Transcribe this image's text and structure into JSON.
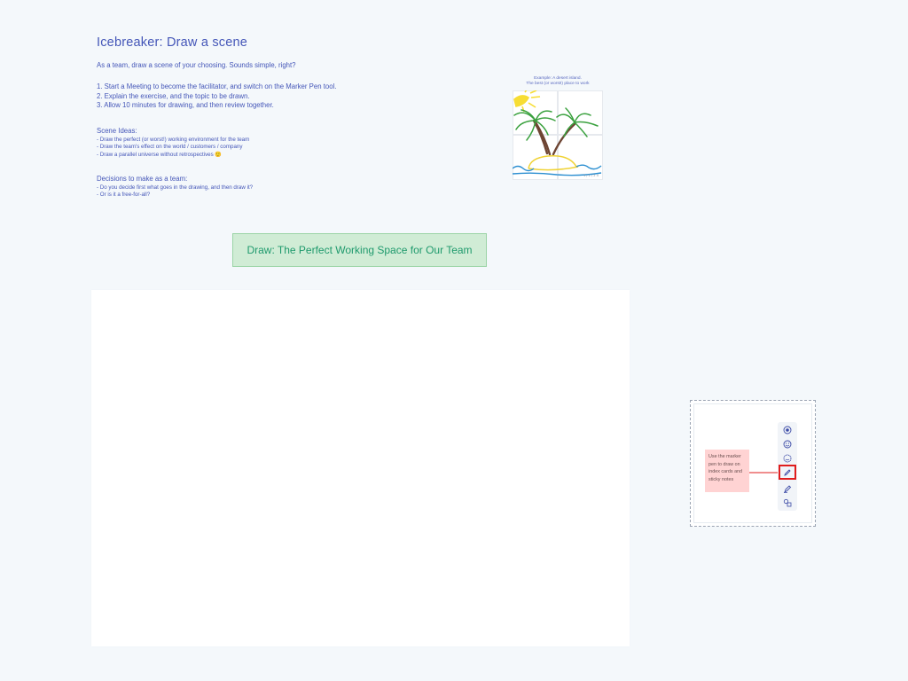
{
  "header": {
    "title": "Icebreaker: Draw a scene",
    "intro": "As a team, draw a scene of your choosing. Sounds simple, right?"
  },
  "steps": [
    "1. Start a Meeting to become the facilitator, and switch on the Marker Pen tool.",
    "2. Explain the exercise, and the topic to be drawn.",
    "3. Allow 10 minutes for drawing, and then review together."
  ],
  "scene_ideas": {
    "heading": "Scene Ideas:",
    "items": [
      "- Draw the perfect (or worst!) working environment for the team",
      "- Draw the team's effect on the world / customers / company",
      "- Draw a parallel universe without retrospectives 🙂"
    ]
  },
  "decisions": {
    "heading": "Decisions to make as a team:",
    "items": [
      "- Do you decide first what goes in the drawing, and then draw it?",
      "- Or is it a free-for-all?"
    ]
  },
  "example": {
    "caption_line1": "Example: A desert island.",
    "caption_line2": "The best (or worst!) place to work",
    "corner_label": "1 / 1 / 2 4",
    "colors": {
      "sun": "#f7dd33",
      "trunk": "#6e4533",
      "leaves": "#3aa13e",
      "sand": "#f0d336",
      "water": "#2c8fd1"
    }
  },
  "draw_banner": {
    "label": "Draw: The Perfect Working Space for Our Team"
  },
  "help": {
    "note_text": "Use the marker pen to draw on index cards and sticky notes",
    "tools": [
      "reaction-icon",
      "emoji-icon",
      "smiley-icon",
      "marker-pen-icon",
      "highlighter-icon",
      "shapes-icon"
    ],
    "colors": {
      "highlight": "#e01d1d",
      "note": "#ffd3d3"
    }
  },
  "colors": {
    "background": "#f4f8fb",
    "text": "#4456b8",
    "banner_bg": "#d0ecd5",
    "banner_text": "#1f9a6d"
  }
}
